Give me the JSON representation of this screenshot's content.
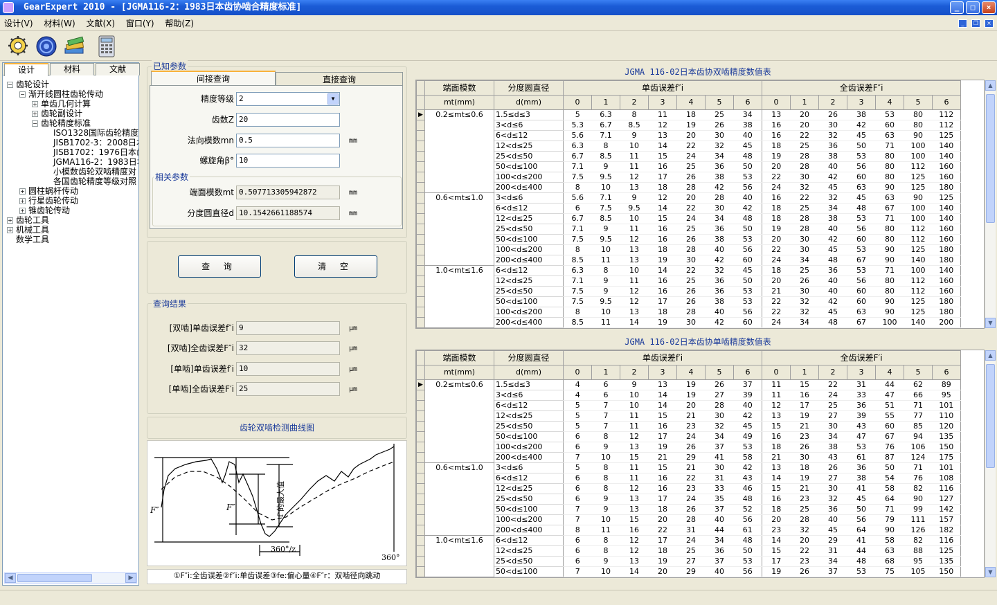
{
  "window": {
    "title": "GearExpert 2010 - [JGMA116-2：1983日本齿协啮合精度标准]"
  },
  "menu": [
    "设计(V)",
    "材料(W)",
    "文献(X)",
    "窗口(Y)",
    "帮助(Z)"
  ],
  "toolbar": [
    "gear-settings-icon",
    "gear-network-icon",
    "books-icon",
    "calculator-icon"
  ],
  "left_tabs": [
    "设计",
    "材料",
    "文献"
  ],
  "tree": [
    {
      "label": "齿轮设计",
      "level": 0,
      "toggle": "-"
    },
    {
      "label": "渐开线圆柱齿轮传动",
      "level": 1,
      "toggle": "-"
    },
    {
      "label": "单齿几何计算",
      "level": 2,
      "toggle": "+"
    },
    {
      "label": "齿轮副设计",
      "level": 2,
      "toggle": "+"
    },
    {
      "label": "齿轮精度标准",
      "level": 2,
      "toggle": "-"
    },
    {
      "label": "ISO1328国际齿轮精度:",
      "level": 3,
      "toggle": ""
    },
    {
      "label": "JISB1702-3：2008日本",
      "level": 3,
      "toggle": ""
    },
    {
      "label": "JISB1702：1976日本齿",
      "level": 3,
      "toggle": ""
    },
    {
      "label": "JGMA116-2：1983日本1",
      "level": 3,
      "toggle": ""
    },
    {
      "label": "小模数齿轮双啮精度对",
      "level": 3,
      "toggle": ""
    },
    {
      "label": "各国齿轮精度等级对照",
      "level": 3,
      "toggle": ""
    },
    {
      "label": "圆柱蜗杆传动",
      "level": 1,
      "toggle": "+"
    },
    {
      "label": "行星齿轮传动",
      "level": 1,
      "toggle": "+"
    },
    {
      "label": "锥齿轮传动",
      "level": 1,
      "toggle": "+"
    },
    {
      "label": "齿轮工具",
      "level": 0,
      "toggle": "+"
    },
    {
      "label": "机械工具",
      "level": 0,
      "toggle": "+"
    },
    {
      "label": "数学工具",
      "level": 0,
      "toggle": ""
    }
  ],
  "known": {
    "caption": "已知参数",
    "tab_indirect": "间接查询",
    "tab_direct": "直接查询",
    "grade_label": "精度等级",
    "grade_value": "2",
    "teeth_label": "齿数Z",
    "teeth_value": "20",
    "mn_label": "法向模数mn",
    "mn_value": "0.5",
    "mn_unit": "mm",
    "beta_label": "螺旋角β°",
    "beta_value": "10"
  },
  "related": {
    "caption": "相关参数",
    "mt_label": "端面模数mt",
    "mt_value": "0.507713305942872",
    "mt_unit": "mm",
    "d_label": "分度圆直径d",
    "d_value": "10.1542661188574",
    "d_unit": "mm"
  },
  "buttons": {
    "query": "查 询",
    "clear": "清 空"
  },
  "results": {
    "caption": "查询结果",
    "items": [
      {
        "label": "[双啮]单齿误差f″i",
        "value": "9",
        "unit": "μm"
      },
      {
        "label": "[双啮]全齿误差F″i",
        "value": "32",
        "unit": "μm"
      },
      {
        "label": "[单啮]单齿误差f′i",
        "value": "10",
        "unit": "μm"
      },
      {
        "label": "[单啮]全齿误差F′i",
        "value": "25",
        "unit": "μm"
      }
    ]
  },
  "curve": {
    "title": "齿轮双啮检测曲线图",
    "label_F": "F″",
    "label_F2": "F″",
    "label_max": "f″的最大值",
    "label_pitch": "360°/z",
    "label_360": "360°",
    "legend": "①F″i:全齿误差②f″i:单齿误差③fe:偏心量④F″r：双啮径向跳动"
  },
  "table1": {
    "title": "JGMA 116-02日本齿协双啮精度数值表",
    "h_mt": "端面模数",
    "h_d": "分度圆直径",
    "h_fi": "单齿误差f″i",
    "h_Fi": "全齿误差F″i",
    "h_mt_unit": "mt(mm)",
    "h_d_unit": "d(mm)",
    "grades": [
      "0",
      "1",
      "2",
      "3",
      "4",
      "5",
      "6"
    ],
    "groups": [
      {
        "mt": "0.2≤mt≤0.6",
        "rows": [
          {
            "d": "1.5≤d≤3",
            "f": [
              "5",
              "6.3",
              "8",
              "11",
              "18",
              "25",
              "34"
            ],
            "F": [
              "13",
              "20",
              "26",
              "38",
              "53",
              "80",
              "112"
            ]
          },
          {
            "d": "3<d≤6",
            "f": [
              "5.3",
              "6.7",
              "8.5",
              "12",
              "19",
              "26",
              "38"
            ],
            "F": [
              "16",
              "20",
              "30",
              "42",
              "60",
              "80",
              "112"
            ]
          },
          {
            "d": "6<d≤12",
            "f": [
              "5.6",
              "7.1",
              "9",
              "13",
              "20",
              "30",
              "40"
            ],
            "F": [
              "16",
              "22",
              "32",
              "45",
              "63",
              "90",
              "125"
            ]
          },
          {
            "d": "12<d≤25",
            "f": [
              "6.3",
              "8",
              "10",
              "14",
              "22",
              "32",
              "45"
            ],
            "F": [
              "18",
              "25",
              "36",
              "50",
              "71",
              "100",
              "140"
            ]
          },
          {
            "d": "25<d≤50",
            "f": [
              "6.7",
              "8.5",
              "11",
              "15",
              "24",
              "34",
              "48"
            ],
            "F": [
              "19",
              "28",
              "38",
              "53",
              "80",
              "100",
              "140"
            ]
          },
          {
            "d": "50<d≤100",
            "f": [
              "7.1",
              "9",
              "11",
              "16",
              "25",
              "36",
              "50"
            ],
            "F": [
              "20",
              "28",
              "40",
              "56",
              "80",
              "112",
              "160"
            ]
          },
          {
            "d": "100<d≤200",
            "f": [
              "7.5",
              "9.5",
              "12",
              "17",
              "26",
              "38",
              "53"
            ],
            "F": [
              "22",
              "30",
              "42",
              "60",
              "80",
              "125",
              "160"
            ]
          },
          {
            "d": "200<d≤400",
            "f": [
              "8",
              "10",
              "13",
              "18",
              "28",
              "42",
              "56"
            ],
            "F": [
              "24",
              "32",
              "45",
              "63",
              "90",
              "125",
              "180"
            ]
          }
        ]
      },
      {
        "mt": "0.6<mt≤1.0",
        "rows": [
          {
            "d": "3<d≤6",
            "f": [
              "5.6",
              "7.1",
              "9",
              "12",
              "20",
              "28",
              "40"
            ],
            "F": [
              "16",
              "22",
              "32",
              "45",
              "63",
              "90",
              "125"
            ]
          },
          {
            "d": "6<d≤12",
            "f": [
              "6",
              "7.5",
              "9.5",
              "14",
              "22",
              "30",
              "42"
            ],
            "F": [
              "18",
              "25",
              "34",
              "48",
              "67",
              "100",
              "140"
            ]
          },
          {
            "d": "12<d≤25",
            "f": [
              "6.7",
              "8.5",
              "10",
              "15",
              "24",
              "34",
              "48"
            ],
            "F": [
              "18",
              "28",
              "38",
              "53",
              "71",
              "100",
              "140"
            ]
          },
          {
            "d": "25<d≤50",
            "f": [
              "7.1",
              "9",
              "11",
              "16",
              "25",
              "36",
              "50"
            ],
            "F": [
              "19",
              "28",
              "40",
              "56",
              "80",
              "112",
              "160"
            ]
          },
          {
            "d": "50<d≤100",
            "f": [
              "7.5",
              "9.5",
              "12",
              "16",
              "26",
              "38",
              "53"
            ],
            "F": [
              "20",
              "30",
              "42",
              "60",
              "80",
              "112",
              "160"
            ]
          },
          {
            "d": "100<d≤200",
            "f": [
              "8",
              "10",
              "13",
              "18",
              "28",
              "40",
              "56"
            ],
            "F": [
              "22",
              "30",
              "45",
              "53",
              "90",
              "125",
              "180"
            ]
          },
          {
            "d": "200<d≤400",
            "f": [
              "8.5",
              "11",
              "13",
              "19",
              "30",
              "42",
              "60"
            ],
            "F": [
              "24",
              "34",
              "48",
              "67",
              "90",
              "140",
              "180"
            ]
          }
        ]
      },
      {
        "mt": "1.0<mt≤1.6",
        "rows": [
          {
            "d": "6<d≤12",
            "f": [
              "6.3",
              "8",
              "10",
              "14",
              "22",
              "32",
              "45"
            ],
            "F": [
              "18",
              "25",
              "36",
              "53",
              "71",
              "100",
              "140"
            ]
          },
          {
            "d": "12<d≤25",
            "f": [
              "7.1",
              "9",
              "11",
              "16",
              "25",
              "36",
              "50"
            ],
            "F": [
              "20",
              "26",
              "40",
              "56",
              "80",
              "112",
              "160"
            ]
          },
          {
            "d": "25<d≤50",
            "f": [
              "7.5",
              "9",
              "12",
              "16",
              "26",
              "36",
              "53"
            ],
            "F": [
              "21",
              "30",
              "40",
              "60",
              "80",
              "112",
              "160"
            ]
          },
          {
            "d": "50<d≤100",
            "f": [
              "7.5",
              "9.5",
              "12",
              "17",
              "26",
              "38",
              "53"
            ],
            "F": [
              "22",
              "32",
              "42",
              "60",
              "90",
              "125",
              "180"
            ]
          },
          {
            "d": "100<d≤200",
            "f": [
              "8",
              "10",
              "13",
              "18",
              "28",
              "40",
              "56"
            ],
            "F": [
              "22",
              "32",
              "45",
              "63",
              "90",
              "125",
              "180"
            ]
          },
          {
            "d": "200<d≤400",
            "f": [
              "8.5",
              "11",
              "14",
              "19",
              "30",
              "42",
              "60"
            ],
            "F": [
              "24",
              "34",
              "48",
              "67",
              "100",
              "140",
              "200"
            ]
          }
        ]
      }
    ]
  },
  "table2": {
    "title": "JGMA 116-02日本齿协单啮精度数值表",
    "h_mt": "端面模数",
    "h_d": "分度圆直径",
    "h_fi": "单齿误差f′i",
    "h_Fi": "全齿误差F′i",
    "h_mt_unit": "mt(mm)",
    "h_d_unit": "d(mm)",
    "grades": [
      "0",
      "1",
      "2",
      "3",
      "4",
      "5",
      "6"
    ],
    "groups": [
      {
        "mt": "0.2≤mt≤0.6",
        "rows": [
          {
            "d": "1.5≤d≤3",
            "f": [
              "4",
              "6",
              "9",
              "13",
              "19",
              "26",
              "37"
            ],
            "F": [
              "11",
              "15",
              "22",
              "31",
              "44",
              "62",
              "89"
            ]
          },
          {
            "d": "3<d≤6",
            "f": [
              "4",
              "6",
              "10",
              "14",
              "19",
              "27",
              "39"
            ],
            "F": [
              "11",
              "16",
              "24",
              "33",
              "47",
              "66",
              "95"
            ]
          },
          {
            "d": "6<d≤12",
            "f": [
              "5",
              "7",
              "10",
              "14",
              "20",
              "28",
              "40"
            ],
            "F": [
              "12",
              "17",
              "25",
              "36",
              "51",
              "71",
              "101"
            ]
          },
          {
            "d": "12<d≤25",
            "f": [
              "5",
              "7",
              "11",
              "15",
              "21",
              "30",
              "42"
            ],
            "F": [
              "13",
              "19",
              "27",
              "39",
              "55",
              "77",
              "110"
            ]
          },
          {
            "d": "25<d≤50",
            "f": [
              "5",
              "7",
              "11",
              "16",
              "23",
              "32",
              "45"
            ],
            "F": [
              "15",
              "21",
              "30",
              "43",
              "60",
              "85",
              "120"
            ]
          },
          {
            "d": "50<d≤100",
            "f": [
              "6",
              "8",
              "12",
              "17",
              "24",
              "34",
              "49"
            ],
            "F": [
              "16",
              "23",
              "34",
              "47",
              "67",
              "94",
              "135"
            ]
          },
          {
            "d": "100<d≤200",
            "f": [
              "6",
              "9",
              "13",
              "19",
              "26",
              "37",
              "53"
            ],
            "F": [
              "18",
              "26",
              "38",
              "53",
              "76",
              "106",
              "150"
            ]
          },
          {
            "d": "200<d≤400",
            "f": [
              "7",
              "10",
              "15",
              "21",
              "29",
              "41",
              "58"
            ],
            "F": [
              "21",
              "30",
              "43",
              "61",
              "87",
              "124",
              "175"
            ]
          }
        ]
      },
      {
        "mt": "0.6<mt≤1.0",
        "rows": [
          {
            "d": "3<d≤6",
            "f": [
              "5",
              "8",
              "11",
              "15",
              "21",
              "30",
              "42"
            ],
            "F": [
              "13",
              "18",
              "26",
              "36",
              "50",
              "71",
              "101"
            ]
          },
          {
            "d": "6<d≤12",
            "f": [
              "6",
              "8",
              "11",
              "16",
              "22",
              "31",
              "43"
            ],
            "F": [
              "14",
              "19",
              "27",
              "38",
              "54",
              "76",
              "108"
            ]
          },
          {
            "d": "12<d≤25",
            "f": [
              "6",
              "8",
              "12",
              "16",
              "23",
              "33",
              "46"
            ],
            "F": [
              "15",
              "21",
              "30",
              "41",
              "58",
              "82",
              "116"
            ]
          },
          {
            "d": "25<d≤50",
            "f": [
              "6",
              "9",
              "13",
              "17",
              "24",
              "35",
              "48"
            ],
            "F": [
              "16",
              "23",
              "32",
              "45",
              "64",
              "90",
              "127"
            ]
          },
          {
            "d": "50<d≤100",
            "f": [
              "7",
              "9",
              "13",
              "18",
              "26",
              "37",
              "52"
            ],
            "F": [
              "18",
              "25",
              "36",
              "50",
              "71",
              "99",
              "142"
            ]
          },
          {
            "d": "100<d≤200",
            "f": [
              "7",
              "10",
              "15",
              "20",
              "28",
              "40",
              "56"
            ],
            "F": [
              "20",
              "28",
              "40",
              "56",
              "79",
              "111",
              "157"
            ]
          },
          {
            "d": "200<d≤400",
            "f": [
              "8",
              "11",
              "16",
              "22",
              "31",
              "44",
              "61"
            ],
            "F": [
              "23",
              "32",
              "45",
              "64",
              "90",
              "126",
              "182"
            ]
          }
        ]
      },
      {
        "mt": "1.0<mt≤1.6",
        "rows": [
          {
            "d": "6<d≤12",
            "f": [
              "6",
              "8",
              "12",
              "17",
              "24",
              "34",
              "48"
            ],
            "F": [
              "14",
              "20",
              "29",
              "41",
              "58",
              "82",
              "116"
            ]
          },
          {
            "d": "12<d≤25",
            "f": [
              "6",
              "8",
              "12",
              "18",
              "25",
              "36",
              "50"
            ],
            "F": [
              "15",
              "22",
              "31",
              "44",
              "63",
              "88",
              "125"
            ]
          },
          {
            "d": "25<d≤50",
            "f": [
              "6",
              "9",
              "13",
              "19",
              "27",
              "37",
              "53"
            ],
            "F": [
              "17",
              "23",
              "34",
              "48",
              "68",
              "95",
              "135"
            ]
          },
          {
            "d": "50<d≤100",
            "f": [
              "7",
              "10",
              "14",
              "20",
              "29",
              "40",
              "56"
            ],
            "F": [
              "19",
              "26",
              "37",
              "53",
              "75",
              "105",
              "150"
            ]
          }
        ]
      }
    ]
  }
}
